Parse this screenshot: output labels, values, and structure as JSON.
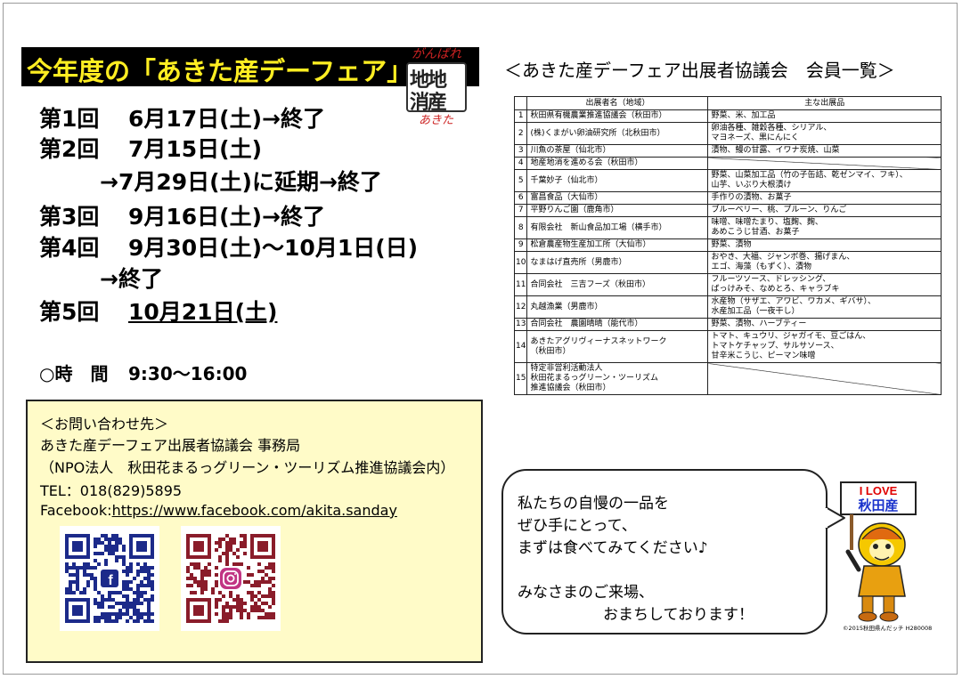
{
  "banner": {
    "title": "今年度の「あきた産デーフェア」"
  },
  "logo": {
    "top": "がんばれ",
    "row1": "地地",
    "row2": "消産",
    "bottom": "あきた"
  },
  "schedule": [
    {
      "head": "第1回",
      "text": "6月17日(土)→終了"
    },
    {
      "head": "第2回",
      "text": "7月15日(土)"
    },
    {
      "head": "",
      "text": "→7月29日(土)に延期→終了",
      "indent": true
    },
    {
      "head": "第3回",
      "text": "9月16日(土)→終了"
    },
    {
      "head": "第4回",
      "text": "9月30日(土)～10月1日(日)"
    },
    {
      "head": "",
      "text": "→終了",
      "indent": true
    },
    {
      "head": "第5回",
      "text": "10月21日(土)",
      "underline": true
    }
  ],
  "time": {
    "label": "○時　間",
    "value": "9:30～16:00"
  },
  "contact": {
    "heading": "＜お問い合わせ先＞",
    "org": "あきた産デーフェア出展者協議会 事務局",
    "org_sub": "（NPO法人　秋田花まるっグリーン・ツーリズム推進協議会内）",
    "tel": "TEL：018(829)5895",
    "facebook_label": "Facebook:",
    "facebook_url": "https://www.facebook.com/akita.sanday",
    "qr_codes": [
      {
        "icon": "facebook-icon",
        "color": "#1c2a8a"
      },
      {
        "icon": "instagram-icon",
        "color": "#8a1c2a"
      }
    ]
  },
  "members": {
    "heading": "＜あきた産デーフェア出展者協議会　会員一覧＞",
    "columns": [
      "",
      "出展者名（地域）",
      "主な出展品"
    ],
    "rows": [
      {
        "no": "1",
        "name": [
          "秋田県有機農業推進協議会（秋田市）"
        ],
        "products": [
          "野菜、米、加工品"
        ]
      },
      {
        "no": "2",
        "name": [
          "(株)くまがい卵油研究所（北秋田市）"
        ],
        "products": [
          "卵油各種、雑穀各種、シリアル、",
          "マヨネーズ、黒にんにく"
        ]
      },
      {
        "no": "3",
        "name": [
          "川魚の茶屋（仙北市）"
        ],
        "products": [
          "漬物、鰻の甘露、イワナ炭焼、山菜"
        ]
      },
      {
        "no": "4",
        "name": [
          "地産地消を進める会（秋田市）"
        ],
        "products": []
      },
      {
        "no": "5",
        "name": [
          "千葉妙子（仙北市）"
        ],
        "products": [
          "野菜、山菜加工品（竹の子缶詰、乾ゼンマイ、フキ）、",
          "山芋、いぶり大根漬け"
        ]
      },
      {
        "no": "6",
        "name": [
          "富昌食品（大仙市）"
        ],
        "products": [
          "手作りの漬物、お菓子"
        ]
      },
      {
        "no": "7",
        "name": [
          "平野りんご園（鹿角市）"
        ],
        "products": [
          "ブルーベリー、桃、プルーン、りんご"
        ]
      },
      {
        "no": "8",
        "name": [
          "有限会社　新山食品加工場（横手市）"
        ],
        "products": [
          "味噌、味噌たまり、塩麹、麹、",
          "あめこうじ甘酒、お菓子"
        ]
      },
      {
        "no": "9",
        "name": [
          "松倉農産物生産加工所（大仙市）"
        ],
        "products": [
          "野菜、漬物"
        ]
      },
      {
        "no": "10",
        "name": [
          "なまはげ直売所（男鹿市）"
        ],
        "products": [
          "おやき、大福、ジャンボ巻、揚げまん、",
          "エゴ、海藻（もずく）、漬物"
        ]
      },
      {
        "no": "11",
        "name": [
          "合同会社　三吉フーズ（秋田市）"
        ],
        "products": [
          "フルーツソース、ドレッシング、",
          "ばっけみそ、なめとろ、キャラブキ"
        ]
      },
      {
        "no": "12",
        "name": [
          "丸越漁業（男鹿市）"
        ],
        "products": [
          "水産物（サザエ、アワビ、ワカメ、ギバサ）、",
          "水産加工品（一夜干し）"
        ]
      },
      {
        "no": "13",
        "name": [
          "合同会社　農園晴晴（能代市）"
        ],
        "products": [
          "野菜、漬物、ハーブティー"
        ]
      },
      {
        "no": "14",
        "name": [
          "あきたアグリヴィーナスネットワーク",
          "（秋田市）"
        ],
        "products": [
          "トマト、キュウリ、ジャガイモ、豆ごはん、",
          "トマトケチャップ、サルサソース、",
          "甘辛米こうじ、ピーマン味噌"
        ]
      },
      {
        "no": "15",
        "name": [
          "特定非営利活動法人",
          "秋田花まるっグリーン・ツーリズム",
          "推進協議会（秋田市）"
        ],
        "products": []
      }
    ]
  },
  "bubble": {
    "lines": [
      "私たちの自慢の一品を",
      "ぜひ手にとって、",
      "まずは食べてみてください♪",
      "",
      "みなさまのご来場、",
      "おまちしております！"
    ]
  },
  "mascot": {
    "sign_line1": "I LOVE",
    "sign_line2": "秋田産",
    "credit": "©2015秋田県んだッチ H280008"
  },
  "colors": {
    "banner_bg": "#000000",
    "banner_text": "#ffee22",
    "contact_bg": "#fffbc8",
    "logo_red": "#cc2222"
  }
}
